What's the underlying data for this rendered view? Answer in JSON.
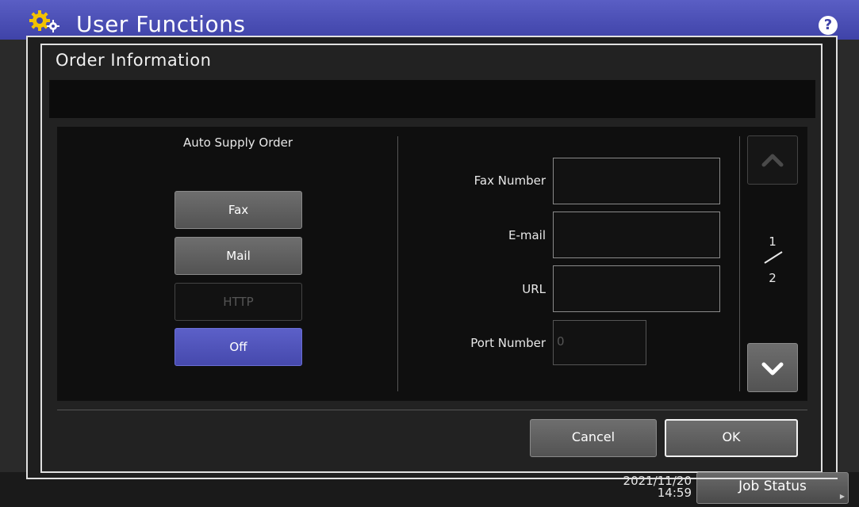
{
  "app": {
    "title": "User Functions",
    "help_label": "?",
    "clock_date": "2021/11/20",
    "clock_time": "14:59",
    "job_status_label": "Job Status"
  },
  "dialog": {
    "title": "Order Information",
    "message": "",
    "auto_supply": {
      "label": "Auto Supply Order",
      "options": [
        {
          "label": "Fax",
          "state": "normal"
        },
        {
          "label": "Mail",
          "state": "normal"
        },
        {
          "label": "HTTP",
          "state": "disabled"
        },
        {
          "label": "Off",
          "state": "selected"
        }
      ],
      "selected": "Off"
    },
    "fields": [
      {
        "label": "Fax Number",
        "value": ""
      },
      {
        "label": "E-mail",
        "value": ""
      },
      {
        "label": "URL",
        "value": ""
      },
      {
        "label": "Port Number",
        "value": "0"
      }
    ],
    "pagination": {
      "current": "1",
      "total": "2"
    },
    "cancel_label": "Cancel",
    "ok_label": "OK"
  },
  "colors": {
    "accent": "#4f53b8",
    "selected_button": "#5356bf",
    "panel_bg": "#0f0f0f"
  },
  "icons": {
    "header": "gear-icon",
    "help": "help-icon",
    "scroll_up": "chevron-up-icon",
    "scroll_down": "chevron-down-icon"
  }
}
